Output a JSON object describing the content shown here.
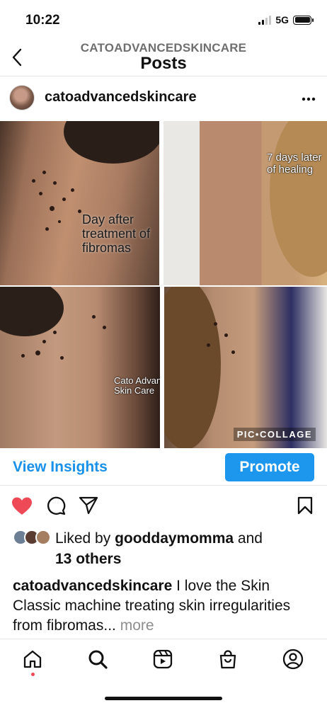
{
  "status_bar": {
    "time": "10:22",
    "network": "5G",
    "battery_level": 1.0
  },
  "header": {
    "account_name": "CATOADVANCEDSKINCARE",
    "title": "Posts",
    "back_icon": "chevron-left-icon"
  },
  "post": {
    "username": "catoadvancedskincare",
    "more_icon": "more-horizontal-icon",
    "image": {
      "overlay_1": "Day after treatment of fibromas",
      "overlay_2": "7 days later of healing",
      "overlay_3": "Cato Advanced Skin Care",
      "watermark": "PIC•COLLAGE"
    },
    "insights_label": "View Insights",
    "promote_label": "Promote",
    "actions": {
      "like_icon": "heart-filled-icon",
      "comment_icon": "comment-icon",
      "share_icon": "send-icon",
      "save_icon": "bookmark-icon",
      "like_color": "#ed4956"
    },
    "likes": {
      "prefix": "Liked by ",
      "user": "gooddaymomma",
      "joiner": " and",
      "others": "13 others"
    },
    "caption": {
      "user": "catoadvancedskincare",
      "text": " I love the Skin Classic machine treating skin irregularities from fibromas...",
      "more": " more"
    }
  },
  "tab_bar": {
    "items": [
      "home-icon",
      "search-icon",
      "reels-icon",
      "shop-icon",
      "profile-icon"
    ],
    "accent_color": "#1d96ee"
  }
}
